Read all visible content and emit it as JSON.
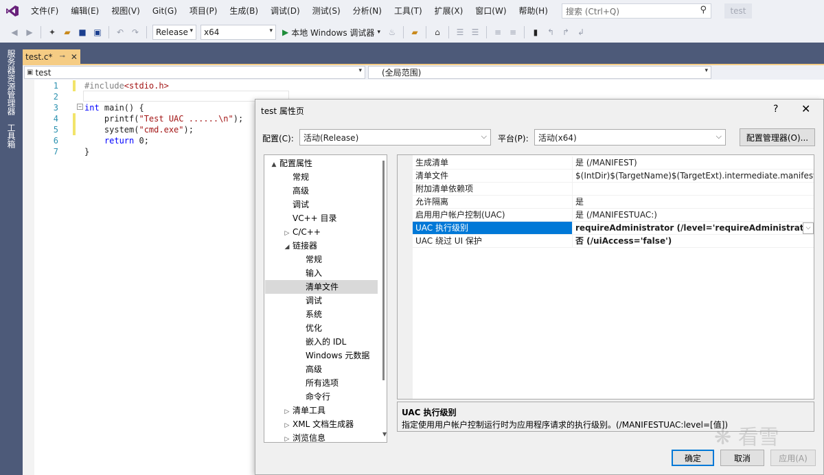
{
  "menu": [
    "文件(F)",
    "编辑(E)",
    "视图(V)",
    "Git(G)",
    "项目(P)",
    "生成(B)",
    "调试(D)",
    "测试(S)",
    "分析(N)",
    "工具(T)",
    "扩展(X)",
    "窗口(W)",
    "帮助(H)"
  ],
  "search": {
    "placeholder": "搜索 (Ctrl+Q)"
  },
  "window_title": "test",
  "toolbar": {
    "config": "Release",
    "platform": "x64",
    "run_label": "本地 Windows 调试器"
  },
  "side_tabs": [
    "服务器资源管理器",
    "工具箱"
  ],
  "doc_tab": {
    "name": "test.c*"
  },
  "navbar": {
    "scope_left": "test",
    "scope_right": "(全局范围)"
  },
  "code_lines": [
    {
      "n": "1",
      "text": "#include<stdio.h>"
    },
    {
      "n": "2",
      "text": ""
    },
    {
      "n": "3",
      "text": "int main() {"
    },
    {
      "n": "4",
      "text": "    printf(\"Test UAC ......\\n\");"
    },
    {
      "n": "5",
      "text": "    system(\"cmd.exe\");"
    },
    {
      "n": "6",
      "text": "    return 0;"
    },
    {
      "n": "7",
      "text": "}"
    }
  ],
  "dialog": {
    "title": "test 属性页",
    "help": "?",
    "config_label": "配置(C):",
    "config_value": "活动(Release)",
    "platform_label": "平台(P):",
    "platform_value": "活动(x64)",
    "config_manager": "配置管理器(O)...",
    "tree": [
      {
        "label": "配置属性",
        "level": 0,
        "exp": "▲"
      },
      {
        "label": "常规",
        "level": 1,
        "exp": ""
      },
      {
        "label": "高级",
        "level": 1,
        "exp": ""
      },
      {
        "label": "调试",
        "level": 1,
        "exp": ""
      },
      {
        "label": "VC++ 目录",
        "level": 1,
        "exp": ""
      },
      {
        "label": "C/C++",
        "level": 1,
        "exp": "▷"
      },
      {
        "label": "链接器",
        "level": 1,
        "exp": "◢"
      },
      {
        "label": "常规",
        "level": 2,
        "exp": ""
      },
      {
        "label": "输入",
        "level": 2,
        "exp": ""
      },
      {
        "label": "清单文件",
        "level": 2,
        "exp": "",
        "selected": true
      },
      {
        "label": "调试",
        "level": 2,
        "exp": ""
      },
      {
        "label": "系统",
        "level": 2,
        "exp": ""
      },
      {
        "label": "优化",
        "level": 2,
        "exp": ""
      },
      {
        "label": "嵌入的 IDL",
        "level": 2,
        "exp": ""
      },
      {
        "label": "Windows 元数据",
        "level": 2,
        "exp": ""
      },
      {
        "label": "高级",
        "level": 2,
        "exp": ""
      },
      {
        "label": "所有选项",
        "level": 2,
        "exp": ""
      },
      {
        "label": "命令行",
        "level": 2,
        "exp": ""
      },
      {
        "label": "清单工具",
        "level": 1,
        "exp": "▷"
      },
      {
        "label": "XML 文档生成器",
        "level": 1,
        "exp": "▷"
      },
      {
        "label": "浏览信息",
        "level": 1,
        "exp": "▷"
      }
    ],
    "properties": [
      {
        "name": "生成清单",
        "value": "是 (/MANIFEST)",
        "bold": false
      },
      {
        "name": "清单文件",
        "value": "$(IntDir)$(TargetName)$(TargetExt).intermediate.manifest",
        "bold": false
      },
      {
        "name": "附加清单依赖项",
        "value": "",
        "bold": false
      },
      {
        "name": "允许隔离",
        "value": "是",
        "bold": false
      },
      {
        "name": "启用用户帐户控制(UAC)",
        "value": "是 (/MANIFESTUAC:)",
        "bold": false
      },
      {
        "name": "UAC 执行级别",
        "value": "requireAdministrator (/level='requireAdministrator')",
        "bold": true,
        "selected": true
      },
      {
        "name": "UAC 绕过 UI 保护",
        "value": "否 (/uiAccess='false')",
        "bold": true
      }
    ],
    "desc_title": "UAC 执行级别",
    "desc_text": "指定使用用户帐户控制运行时为应用程序请求的执行级别。(/MANIFESTUAC:level=[值])",
    "ok": "确定",
    "cancel": "取消",
    "apply": "应用(A)"
  },
  "watermark": "看雪"
}
